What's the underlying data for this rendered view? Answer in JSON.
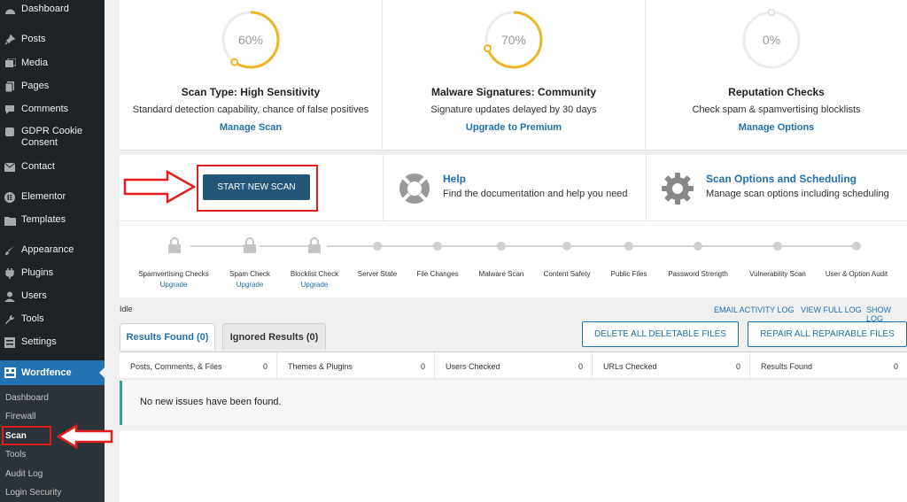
{
  "sidebar": {
    "items": [
      {
        "label": "Dashboard",
        "icon": "dashboard-icon"
      },
      {
        "label": "Posts",
        "icon": "pin-icon"
      },
      {
        "label": "Media",
        "icon": "media-icon"
      },
      {
        "label": "Pages",
        "icon": "pages-icon"
      },
      {
        "label": "Comments",
        "icon": "comment-icon"
      },
      {
        "label": "GDPR Cookie Consent",
        "icon": "cookie-icon"
      },
      {
        "label": "Contact",
        "icon": "mail-icon"
      },
      {
        "label": "Elementor",
        "icon": "elementor-icon"
      },
      {
        "label": "Templates",
        "icon": "folder-icon"
      },
      {
        "label": "Appearance",
        "icon": "brush-icon"
      },
      {
        "label": "Plugins",
        "icon": "plug-icon"
      },
      {
        "label": "Users",
        "icon": "user-icon"
      },
      {
        "label": "Tools",
        "icon": "wrench-icon"
      },
      {
        "label": "Settings",
        "icon": "settings-icon"
      }
    ],
    "active": {
      "label": "Wordfence",
      "icon": "wordfence-icon"
    },
    "submenu": [
      "Dashboard",
      "Firewall",
      "Scan",
      "Tools",
      "Audit Log",
      "Login Security"
    ]
  },
  "cards": [
    {
      "percent": "60%",
      "progress": 0.6,
      "title": "Scan Type: High Sensitivity",
      "desc": "Standard detection capability, chance of false positives",
      "link": "Manage Scan"
    },
    {
      "percent": "70%",
      "progress": 0.7,
      "title": "Malware Signatures: Community",
      "desc": "Signature updates delayed by 30 days",
      "link": "Upgrade to Premium"
    },
    {
      "percent": "0%",
      "progress": 0.0,
      "title": "Reputation Checks",
      "desc": "Check spam & spamvertising blocklists",
      "link": "Manage Options"
    }
  ],
  "actions": {
    "start_label": "START NEW SCAN",
    "help_title": "Help",
    "help_desc": "Find the documentation and help you need",
    "options_title": "Scan Options and Scheduling",
    "options_desc": "Manage scan options including scheduling"
  },
  "steps": [
    {
      "label": "Spamvertising Checks",
      "sub": "Upgrade",
      "locked": true
    },
    {
      "label": "Spam Check",
      "sub": "Upgrade",
      "locked": true
    },
    {
      "label": "Blocklist Check",
      "sub": "Upgrade",
      "locked": true
    },
    {
      "label": "Server State",
      "sub": "",
      "locked": false
    },
    {
      "label": "File Changes",
      "sub": "",
      "locked": false
    },
    {
      "label": "Malware Scan",
      "sub": "",
      "locked": false
    },
    {
      "label": "Content Safety",
      "sub": "",
      "locked": false
    },
    {
      "label": "Public Files",
      "sub": "",
      "locked": false
    },
    {
      "label": "Password Strength",
      "sub": "",
      "locked": false
    },
    {
      "label": "Vulnerability Scan",
      "sub": "",
      "locked": false
    },
    {
      "label": "User & Option Audit",
      "sub": "",
      "locked": false
    }
  ],
  "status": "Idle",
  "logs": {
    "email": "EMAIL ACTIVITY LOG",
    "full": "VIEW FULL LOG",
    "show": "SHOW LOG"
  },
  "tabs": {
    "results": "Results Found (0)",
    "ignored": "Ignored Results (0)"
  },
  "bulk": {
    "delete": "DELETE ALL DELETABLE FILES",
    "repair": "REPAIR ALL REPAIRABLE FILES"
  },
  "summary": [
    {
      "label": "Posts, Comments, & Files",
      "value": "0"
    },
    {
      "label": "Themes & Plugins",
      "value": "0"
    },
    {
      "label": "Users Checked",
      "value": "0"
    },
    {
      "label": "URLs Checked",
      "value": "0"
    },
    {
      "label": "Results Found",
      "value": "0"
    }
  ],
  "issues_text": "No new issues have been found.",
  "colors": {
    "accent": "#2271b1",
    "ring": "#f0b429",
    "sidebar": "#1d2327",
    "highlight": "#e11d1d"
  }
}
